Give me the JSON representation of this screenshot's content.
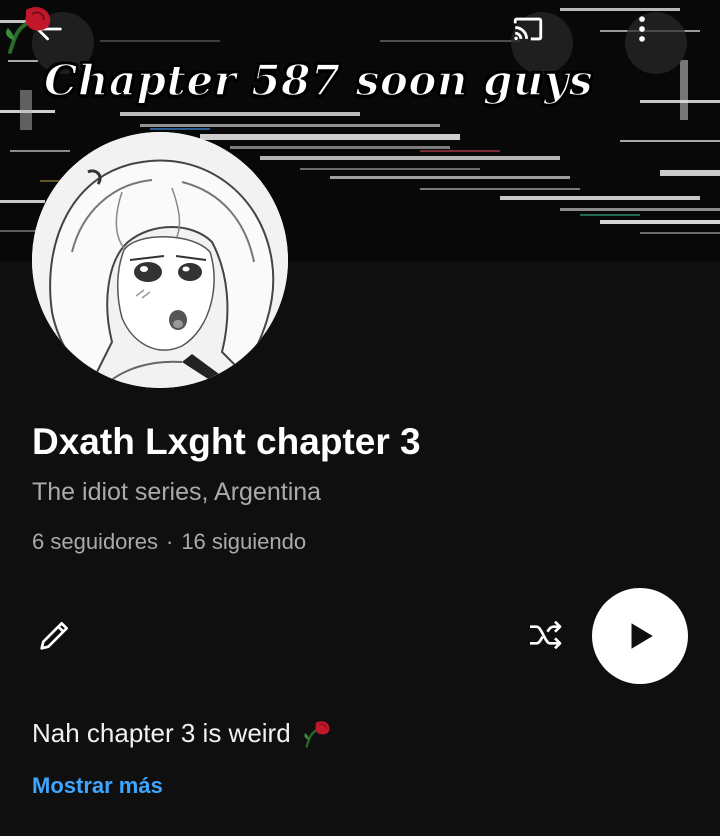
{
  "header": {
    "back_icon": "arrow-left-icon",
    "cast_icon": "cast-icon",
    "more_icon": "more-vertical-icon",
    "banner_caption": "Chapter 587 soon guys",
    "banner_emoji": "wilted-rose-icon"
  },
  "profile": {
    "avatar": "anime-girl-avatar",
    "title": "Dxath Lxght chapter 3",
    "subtitle": "The idiot series, Argentina",
    "followers": "6 seguidores",
    "separator": "·",
    "following": "16 siguiendo"
  },
  "actions": {
    "edit_icon": "pencil-icon",
    "shuffle_icon": "shuffle-icon",
    "play_icon": "play-icon"
  },
  "description": {
    "text": "Nah chapter 3 is weird",
    "emoji": "wilted-rose-icon",
    "show_more": "Mostrar más"
  },
  "colors": {
    "background": "#0f0f0f",
    "link": "#3ea6ff",
    "secondary_text": "#aaaaaa",
    "rose": "#c0182a"
  }
}
